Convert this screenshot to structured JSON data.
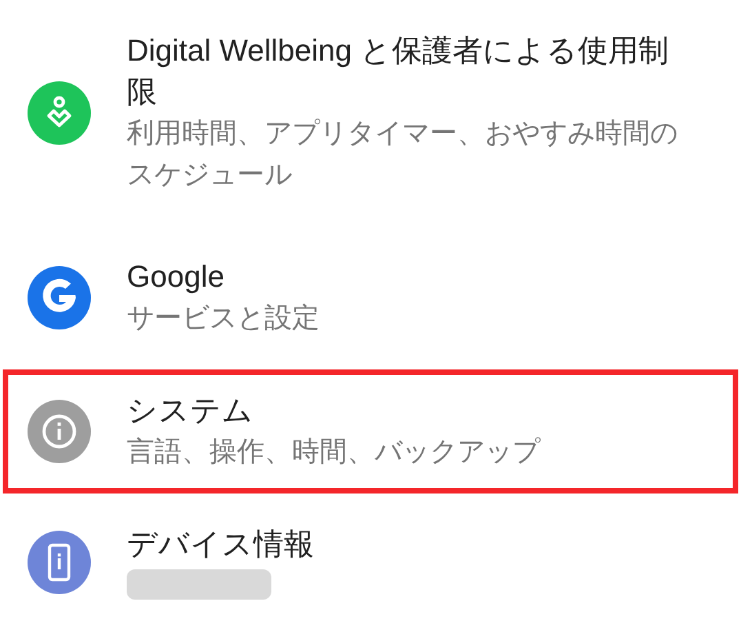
{
  "settings_items": [
    {
      "title": "Digital Wellbeing と保護者による使用制限",
      "subtitle": "利用時間、アプリタイマー、おやすみ時間のスケジュール",
      "highlighted": false
    },
    {
      "title": "Google",
      "subtitle": "サービスと設定",
      "highlighted": false
    },
    {
      "title": "システム",
      "subtitle": "言語、操作、時間、バックアップ",
      "highlighted": true
    },
    {
      "title": "デバイス情報",
      "redacted_subtitle": true,
      "highlighted": false
    }
  ]
}
